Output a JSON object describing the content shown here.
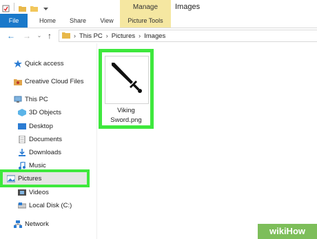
{
  "window": {
    "title": "Images"
  },
  "ribbon": {
    "context_tab": "Manage",
    "tabs": [
      {
        "label": "File"
      },
      {
        "label": "Home"
      },
      {
        "label": "Share"
      },
      {
        "label": "View"
      },
      {
        "label": "Picture Tools"
      }
    ]
  },
  "address": {
    "crumbs": [
      "This PC",
      "Pictures",
      "Images"
    ]
  },
  "nav": {
    "items": [
      {
        "label": "Quick access"
      },
      {
        "label": "Creative Cloud Files"
      },
      {
        "label": "This PC"
      },
      {
        "label": "3D Objects"
      },
      {
        "label": "Desktop"
      },
      {
        "label": "Documents"
      },
      {
        "label": "Downloads"
      },
      {
        "label": "Music"
      },
      {
        "label": "Pictures"
      },
      {
        "label": "Videos"
      },
      {
        "label": "Local Disk (C:)"
      },
      {
        "label": "Network"
      }
    ],
    "selected": "Pictures"
  },
  "files": [
    {
      "name_line1": "Viking",
      "name_line2": "Sword.png"
    }
  ],
  "watermark": {
    "text": "wikiHow"
  },
  "colors": {
    "accent": "#1979ca",
    "highlight": "#3ee83d",
    "context_tab": "#f5e7a1"
  }
}
